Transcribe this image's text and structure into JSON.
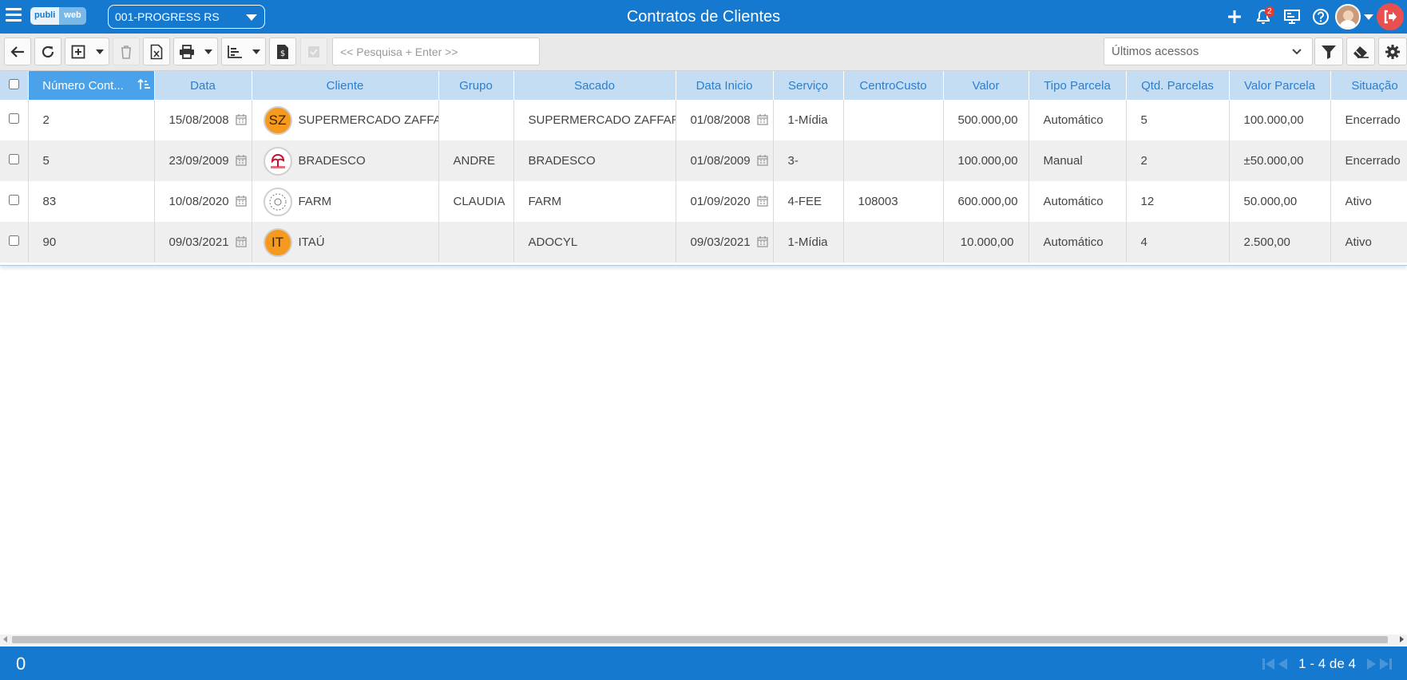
{
  "header": {
    "title": "Contratos de Clientes",
    "logo_part1": "publi",
    "logo_part2": "web",
    "company_selector": "001-PROGRESS RS",
    "notification_count": "2"
  },
  "toolbar": {
    "search_placeholder": "<< Pesquisa + Enter >>",
    "recent_access": "Últimos acessos"
  },
  "table": {
    "columns": [
      "Número Cont...",
      "Data",
      "Cliente",
      "Grupo",
      "Sacado",
      "Data Inicio",
      "Serviço",
      "CentroCusto",
      "Valor",
      "Tipo Parcela",
      "Qtd. Parcelas",
      "Valor Parcela",
      "Situação"
    ],
    "rows": [
      {
        "numero": "2",
        "data": "15/08/2008",
        "cliente_initials": "SZ",
        "cliente": "SUPERMERCADO ZAFFARI",
        "grupo": "",
        "sacado": "SUPERMERCADO ZAFFARI",
        "data_inicio": "01/08/2008",
        "servico": "1-Mídia",
        "centro_custo": "",
        "valor": "500.000,00",
        "tipo_parcela": "Automático",
        "qtd_parcelas": "5",
        "valor_parcela": "100.000,00",
        "situacao": "Encerrado"
      },
      {
        "numero": "5",
        "data": "23/09/2009",
        "cliente_initials": "",
        "cliente": "BRADESCO",
        "grupo": "ANDRE",
        "sacado": "BRADESCO",
        "data_inicio": "01/08/2009",
        "servico": "3-",
        "centro_custo": "",
        "valor": "100.000,00",
        "tipo_parcela": "Manual",
        "qtd_parcelas": "2",
        "valor_parcela": "±50.000,00",
        "situacao": "Encerrado"
      },
      {
        "numero": "83",
        "data": "10/08/2020",
        "cliente_initials": "",
        "cliente": "FARM",
        "grupo": "CLAUDIA",
        "sacado": "FARM",
        "data_inicio": "01/09/2020",
        "servico": "4-FEE",
        "centro_custo": "108003",
        "valor": "600.000,00",
        "tipo_parcela": "Automático",
        "qtd_parcelas": "12",
        "valor_parcela": "50.000,00",
        "situacao": "Ativo"
      },
      {
        "numero": "90",
        "data": "09/03/2021",
        "cliente_initials": "IT",
        "cliente": "ITAÚ",
        "grupo": "",
        "sacado": "ADOCYL",
        "data_inicio": "09/03/2021",
        "servico": "1-Mídia",
        "centro_custo": "",
        "valor": "10.000,00",
        "tipo_parcela": "Automático",
        "qtd_parcelas": "4",
        "valor_parcela": "2.500,00",
        "situacao": "Ativo"
      }
    ]
  },
  "footer": {
    "selected_count": "0",
    "page_info": "1 - 4 de 4"
  },
  "colors": {
    "primary": "#1579cf",
    "header_cell": "#c5ddf2",
    "sorted_header": "#4aa3ea",
    "avatar_orange": "#f59a1e",
    "logout": "#e94f4f"
  }
}
